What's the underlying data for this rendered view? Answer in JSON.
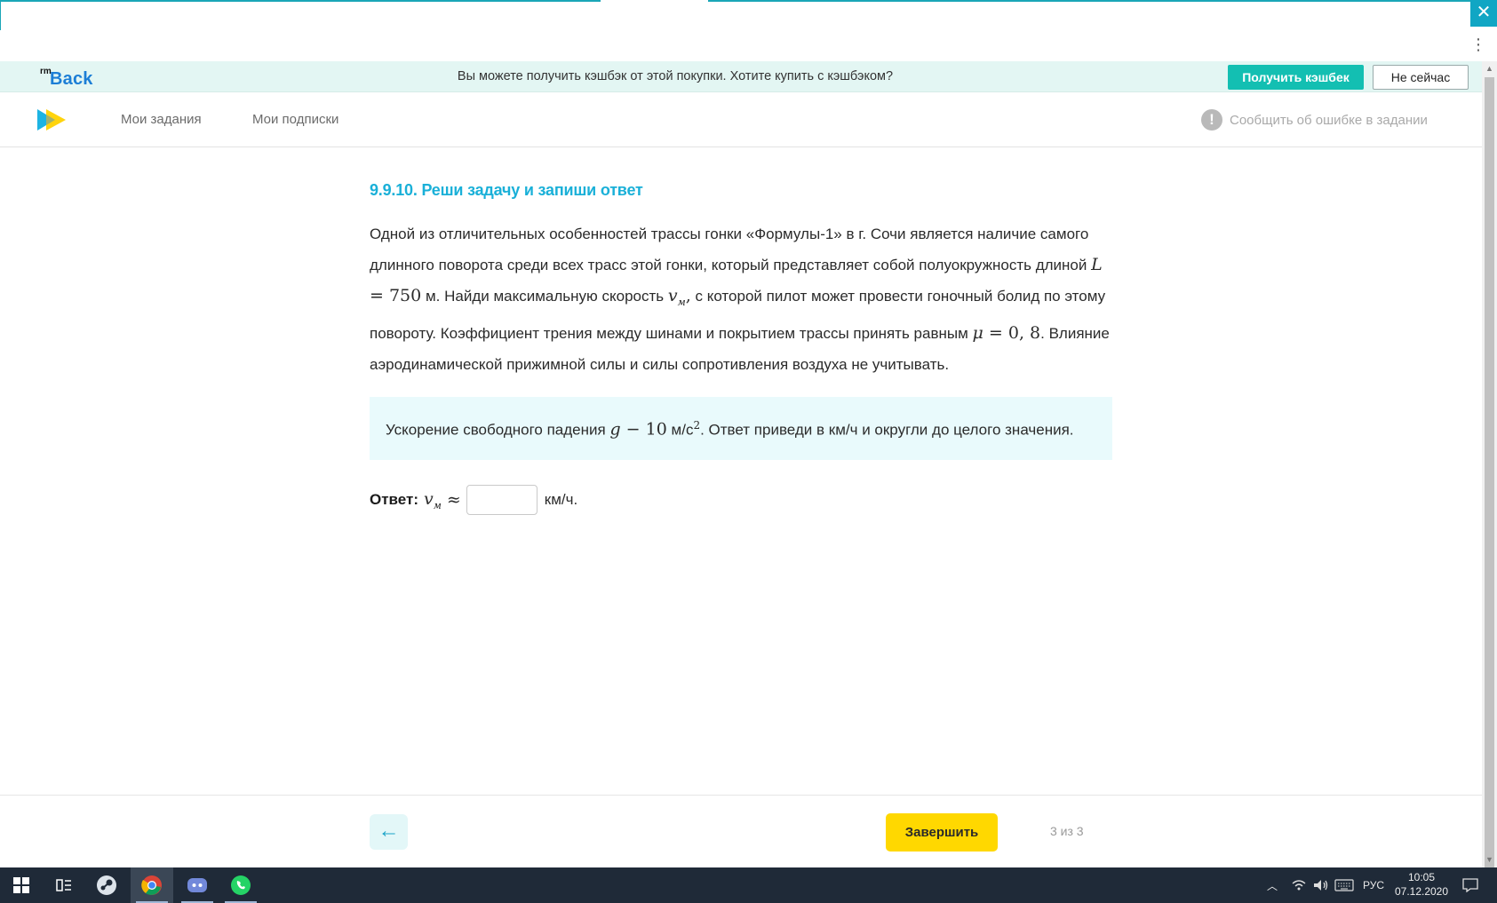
{
  "cashback": {
    "logo_sup": "rm",
    "logo_word": "Back",
    "message": "Вы можете получить кэшбэк от этой покупки. Хотите купить с кэшбэком?",
    "get_label": "Получить кэшбек",
    "later_label": "Не сейчас",
    "accent": "#13bfb2"
  },
  "nav": {
    "items": [
      {
        "label": "Мои задания"
      },
      {
        "label": "Мои подписки"
      }
    ],
    "report_icon": "!",
    "report_label": "Сообщить об ошибке в задании"
  },
  "task": {
    "title": "9.9.10. Реши задачу и запиши ответ",
    "p1": "Одной из отличительных особенностей трассы гонки «Формулы-1» в г. Сочи является наличие самого длинного поворота среди всех трасс этой гонки, который представляет собой полуокружность длиной ",
    "m_L": "L",
    "m_eq": " = ",
    "m_750": "750",
    "p2": " м. Найди максимальную скорость ",
    "m_v": "v",
    "m_sub": "м",
    "m_comma": ",",
    "p3": " с которой пилот может провести гоночный болид по этому повороту. Коэффициент трения между шинами и покрытием трассы принять равным ",
    "m_mu": "μ",
    "m_mu_val": "0, 8",
    "p4": ". Влияние аэродинамической прижимной силы и силы сопротивления воздуха не учитывать."
  },
  "hint": {
    "p1": "Ускорение свободного падения ",
    "m_g": "g",
    "m_minus": " − ",
    "m_10": "10",
    "unit": " м/с",
    "sup": "2",
    "p2": ". Ответ приведи в км/ч и округли до целого значения."
  },
  "answer": {
    "label": "Ответ:",
    "var": "v",
    "sub": "м",
    "approx": "≈",
    "value": "",
    "unit": "км/ч."
  },
  "footer": {
    "back_icon": "←",
    "finish_label": "Завершить",
    "pager": "3 из 3"
  },
  "browser": {
    "close_glyph": "✕",
    "menu_glyph": "⋮"
  },
  "taskbar": {
    "lang": "РУС",
    "time": "10:05",
    "date": "07.12.2020"
  }
}
